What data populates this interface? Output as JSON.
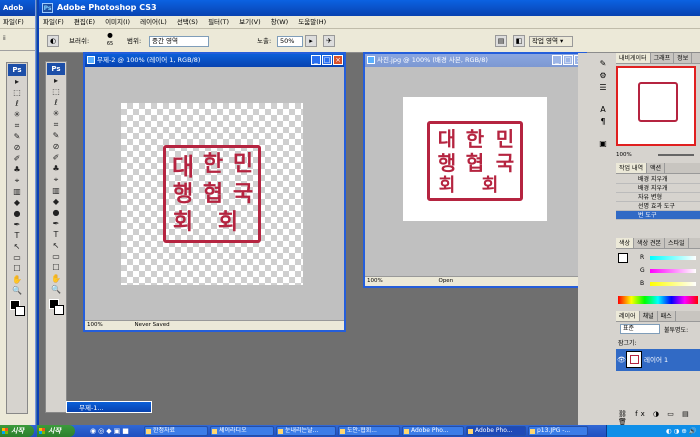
{
  "bg_window": {
    "title": "Adob",
    "menu": "파일(F)",
    "tool_label": "ⅱ"
  },
  "app": {
    "title": "Adobe Photoshop CS3",
    "icon": "Ps"
  },
  "menu": [
    "파일(F)",
    "편집(E)",
    "이미지(I)",
    "레이어(L)",
    "선택(S)",
    "필터(T)",
    "보기(V)",
    "창(W)",
    "도움말(H)"
  ],
  "options": {
    "brush_label": "브러쉬:",
    "brush_size": "65",
    "range_label": "범위:",
    "range_value": "중간 영역",
    "exposure_label": "노출:",
    "exposure_value": "50%",
    "workspace": "작업 영역 ▾"
  },
  "toolbox": {
    "logo": "Ps",
    "tools": [
      "▸",
      "⬚",
      "ℓ",
      "✳",
      "⌗",
      "✎",
      "⊘",
      "✐",
      "♣",
      "⌖",
      "▥",
      "◆",
      "●",
      "✒",
      "T",
      "↖",
      "▭",
      "☐",
      "✋",
      "🔍"
    ]
  },
  "doc1": {
    "title": "무제-2 @ 100% (레이어 1, RGB/8)",
    "zoom": "100%",
    "status": "Never Saved",
    "seal_chars": [
      "대",
      "한",
      "민",
      "국",
      "행",
      "협",
      "회"
    ]
  },
  "doc2": {
    "title": "사진.jpg @ 100% (배경 사본, RGB/8)",
    "zoom": "100%",
    "status": "Open",
    "seal_chars": [
      "대",
      "한",
      "민",
      "국",
      "행",
      "협",
      "회"
    ]
  },
  "panels": {
    "nav_tabs": [
      "내비게이터",
      "그래프",
      "정보"
    ],
    "nav_zoom": "100%",
    "history_tabs": [
      "작업 내역",
      "액션"
    ],
    "history_items": [
      "배경 지우개",
      "배경 지우개",
      "자유 변형",
      "선명 효과 도구",
      "번 도구"
    ],
    "color_tabs": [
      "색상",
      "색상 견본",
      "스타일"
    ],
    "color_rows": [
      "R",
      "G",
      "B"
    ],
    "layer_tabs": [
      "레이어",
      "채널",
      "패스"
    ],
    "blend_mode": "표준",
    "opacity_label": "불투명도:",
    "lock_label": "잠그기:",
    "layer_name": "레이어 1"
  },
  "minimized_doc": "무제-1...",
  "taskbar": {
    "start_back": "시작",
    "start": "시작",
    "buttons": [
      "한정자료",
      "셰이라디오",
      "눈내리는날...",
      "도안-협회...",
      "Adobe Pho...",
      "Adobe Pho...",
      "p13.JPG -..."
    ],
    "tray": "◐ ◑ ⊕ 🔊"
  },
  "colors": {
    "seal_red": "#b52440",
    "title_blue": "#0842b0",
    "selection_blue": "#316ac5"
  }
}
